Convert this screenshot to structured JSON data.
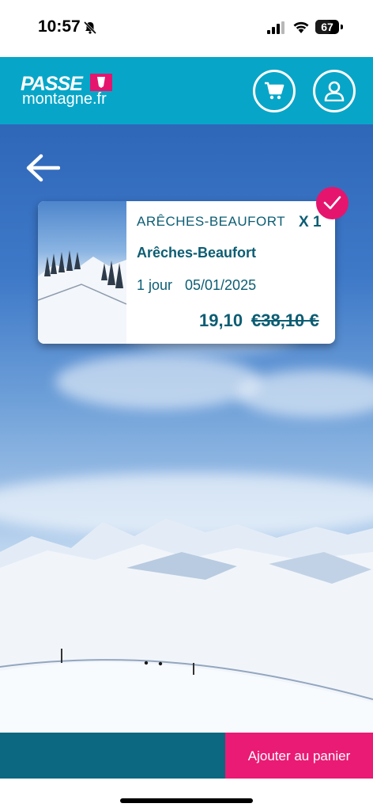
{
  "status_bar": {
    "time": "10:57",
    "battery": "67",
    "battery_level": 0.67,
    "icons": [
      "bell-slash-icon",
      "signal-icon",
      "wifi-icon",
      "battery-icon"
    ]
  },
  "header": {
    "logo_top": "PASSE",
    "logo_bottom": "montagne.fr",
    "cart_icon": "cart-icon",
    "account_icon": "user-icon"
  },
  "navigation": {
    "back_icon": "arrow-left-icon"
  },
  "card": {
    "station": "ARÊCHES-BEAUFORT",
    "quantity": "X 1",
    "name": "Arêches-Beaufort",
    "duration": "1 jour",
    "date": "05/01/2025",
    "price": "19,10",
    "old_price": "€38,10 €",
    "selected_icon": "check-icon"
  },
  "footer": {
    "add_button": "Ajouter au panier"
  },
  "colors": {
    "header": "#07a6c8",
    "accent": "#e5156e",
    "text": "#0c5d73",
    "bottom_bar": "#0b6880"
  }
}
